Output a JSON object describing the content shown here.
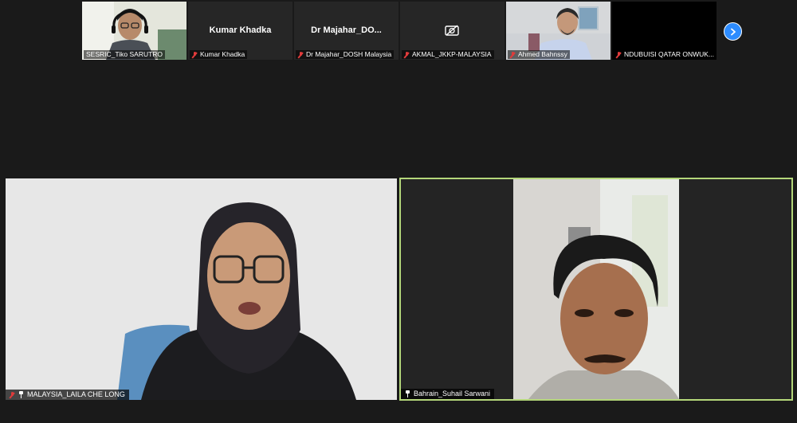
{
  "thumbnails": [
    {
      "label": "SESRIC_Tiko SARUTRO",
      "muted": false,
      "video": true
    },
    {
      "label": "Kumar Khadka",
      "center_name": "Kumar Khadka",
      "muted": true,
      "video": false
    },
    {
      "label": "Dr Majahar_DOSH Malaysia",
      "center_name": "Dr  Majahar_DO...",
      "muted": true,
      "video": false
    },
    {
      "label": "AKMAL_JKKP-MALAYSIA",
      "muted": true,
      "video": false,
      "icon": "camera-off-icon"
    },
    {
      "label": "Ahmed Bahnssy",
      "muted": true,
      "video": true
    },
    {
      "label": "NDUBUISI QATAR ONWUK...",
      "muted": true,
      "video": false
    }
  ],
  "nav": {
    "next_icon": "chevron-right-icon",
    "accent": "#2d8cff"
  },
  "speakers": [
    {
      "label": "MALAYSIA_LAILA CHE LONG",
      "muted": true,
      "pinned": true
    },
    {
      "label": "Bahrain_Suhail Sarwani",
      "muted": false,
      "pinned": true,
      "active_border": "#b4d77a"
    }
  ]
}
